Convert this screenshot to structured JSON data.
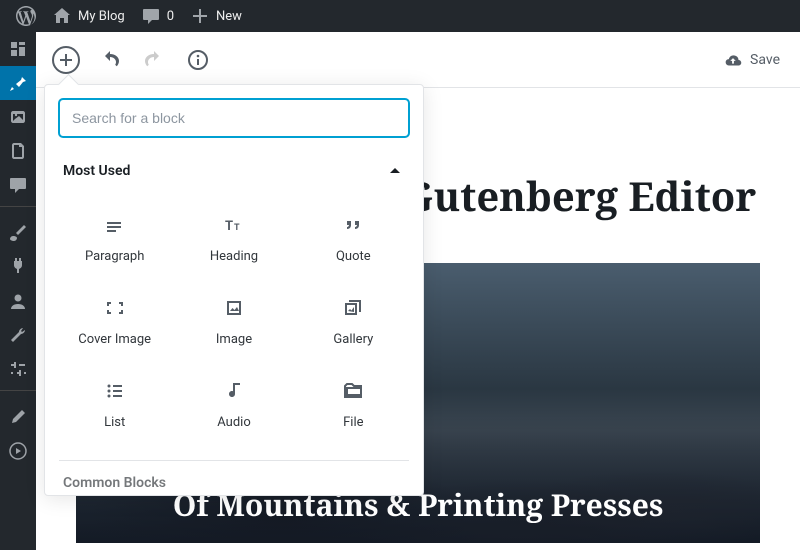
{
  "adminbar": {
    "site_name": "My Blog",
    "comments_count": "0",
    "new_label": "New"
  },
  "toolbar": {
    "save_label": "Save"
  },
  "editor": {
    "page_title": "Welcome to the Gutenberg Editor",
    "cover_title": "Of Mountains & Printing Presses"
  },
  "inserter": {
    "search_placeholder": "Search for a block",
    "sections": {
      "most_used": "Most Used",
      "common_blocks": "Common Blocks"
    },
    "blocks": [
      {
        "label": "Paragraph"
      },
      {
        "label": "Heading"
      },
      {
        "label": "Quote"
      },
      {
        "label": "Cover Image"
      },
      {
        "label": "Image"
      },
      {
        "label": "Gallery"
      },
      {
        "label": "List"
      },
      {
        "label": "Audio"
      },
      {
        "label": "File"
      }
    ]
  }
}
